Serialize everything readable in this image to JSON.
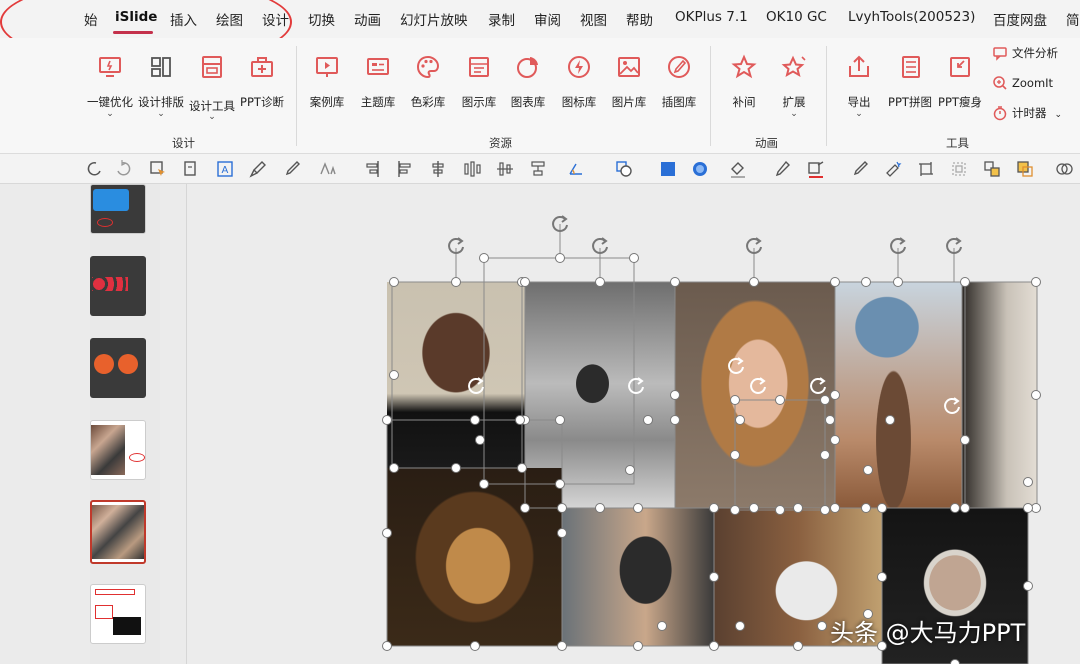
{
  "menu": {
    "tabs": [
      "始",
      "iSlide",
      "插入",
      "绘图",
      "设计",
      "切换",
      "动画",
      "幻灯片放映",
      "录制",
      "审阅",
      "视图",
      "帮助",
      "OKPlus 7.1",
      "OK10 GC",
      "LvyhTools(200523)",
      "百度网盘",
      "简"
    ],
    "active_tab": "iSlide"
  },
  "ribbon": {
    "design_buttons": [
      "一键优化",
      "设计排版",
      "设计工具",
      "PPT诊断"
    ],
    "resource_buttons": [
      "案例库",
      "主题库",
      "色彩库",
      "图示库",
      "图表库",
      "图标库",
      "图片库",
      "插图库"
    ],
    "animation_buttons": [
      "补间",
      "扩展"
    ],
    "tool_buttons": [
      "导出",
      "PPT拼图",
      "PPT瘦身"
    ],
    "tool_small_buttons": [
      "文件分析",
      "ZoomIt",
      "计时器"
    ],
    "groups": [
      "设计",
      "资源",
      "动画",
      "工具"
    ]
  },
  "watermark": "头条 @大马力PPT",
  "colors": {
    "accent": "#e05a5a",
    "tab_underline": "#c4314b",
    "annotation_circle": "#e23a3a"
  }
}
